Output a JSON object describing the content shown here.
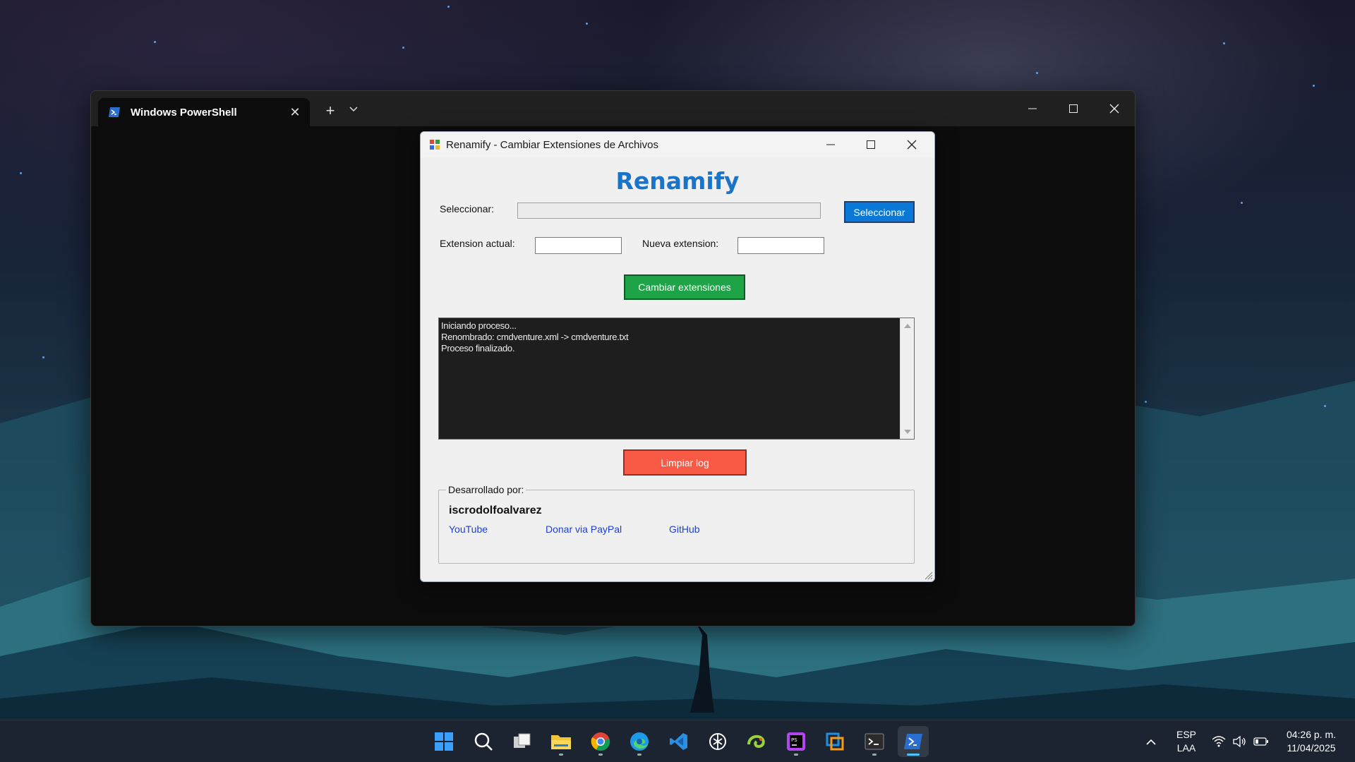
{
  "terminal": {
    "tab_title": "Windows PowerShell",
    "tab_close": "✕",
    "new_tab": "+",
    "dropdown": "⌄"
  },
  "dialog": {
    "title": "Renamify - Cambiar Extensiones de Archivos",
    "brand": "Renamify",
    "select_label": "Seleccionar:",
    "select_path_value": "",
    "select_button": "Seleccionar",
    "current_ext_label": "Extension actual:",
    "current_ext_value": "",
    "new_ext_label": "Nueva extension:",
    "new_ext_value": "",
    "change_button": "Cambiar extensiones",
    "log_lines": [
      "Iniciando proceso...",
      "Renombrado: cmdventure.xml -> cmdventure.txt",
      "Proceso finalizado."
    ],
    "clear_button": "Limpiar log",
    "group_title": "Desarrollado por:",
    "author": "iscrodolfoalvarez",
    "links": {
      "youtube": "YouTube",
      "paypal": "Donar via PayPal",
      "github": "GitHub"
    }
  },
  "taskbar": {
    "apps": [
      "start-icon",
      "search-icon",
      "task-view-icon",
      "file-explorer-icon",
      "chrome-icon",
      "edge-icon",
      "vscode-icon",
      "chatgpt-icon",
      "chameleon-icon",
      "phpstorm-icon",
      "virtualbox-icon",
      "terminal-icon",
      "powershell-icon"
    ],
    "language_top": "ESP",
    "language_bottom": "LAA",
    "time": "04:26 p. m.",
    "date": "11/04/2025"
  },
  "colors": {
    "brand_blue": "#1a74c9",
    "select_button": "#0a78d7",
    "change_button": "#1ea446",
    "clear_button": "#f85a45",
    "log_background": "#1e1e1e",
    "link": "#1e3fd4"
  }
}
